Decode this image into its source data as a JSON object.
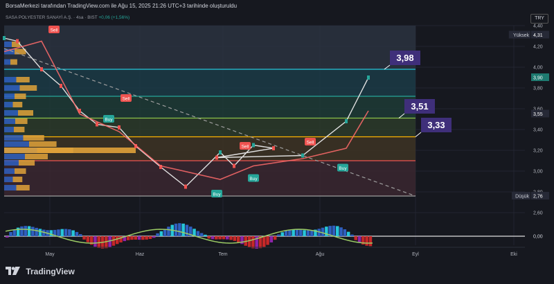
{
  "header": {
    "attribution": "BorsaMerkezi tarafından TradingView.com ile Ağu 15, 2025 21:26 UTC+3 tarihinde oluşturuldu",
    "symbol": "SASA POLYESTER SANAYİ A.Ş. · 4sa · BIST",
    "change": "+0,06 (+1,56%)",
    "currency": "TRY"
  },
  "footer": {
    "brand": "TradingView"
  },
  "chart_data": {
    "type": "line",
    "title": "SASA POLYESTER SANAYİ A.Ş. · 4sa · BIST",
    "y_axis": {
      "range": [
        2.6,
        4.4
      ],
      "ticks": [
        "4,40",
        "4,20",
        "4,00",
        "3,80",
        "3,60",
        "3,40",
        "3,20",
        "3,00",
        "2,80",
        "2,60"
      ],
      "tick_values": [
        4.4,
        4.2,
        4.0,
        3.8,
        3.6,
        3.4,
        3.2,
        3.0,
        2.8,
        2.6
      ]
    },
    "x_axis": {
      "ticks": [
        "May",
        "Haz",
        "Tem",
        "Ağu",
        "Eyl",
        "Eki"
      ]
    },
    "price_labels": [
      {
        "label": "Yüksek",
        "value": "4,31",
        "num": 4.31
      },
      {
        "label": "",
        "value": "3,90",
        "num": 3.9
      },
      {
        "label": "",
        "value": "3,55",
        "num": 3.55
      },
      {
        "label": "Düşük",
        "value": "2,76",
        "num": 2.76
      }
    ],
    "levels": [
      {
        "value": "3,98",
        "num": 3.98,
        "color": "#26c6da"
      },
      {
        "value": "3,51",
        "num": 3.51,
        "color": "#8bc34a"
      },
      {
        "value": "3,33",
        "num": 3.33,
        "color": "#ffb300"
      },
      {
        "value": "",
        "num": 3.1,
        "color": "#ef5350"
      },
      {
        "value": "",
        "num": 2.76,
        "color": "#9e9e9e"
      },
      {
        "value": "",
        "num": 3.72,
        "color": "#26a69a"
      }
    ],
    "series": [
      {
        "name": "price",
        "x": [
          "Nis 22",
          "Nis 29",
          "May 6",
          "May 13",
          "May 20",
          "May 27",
          "Haz 3",
          "Haz 10",
          "Haz 17",
          "Haz 24",
          "Tem 1",
          "Tem 8",
          "Tem 15",
          "Tem 22",
          "Tem 29",
          "Ağu 5",
          "Ağu 12",
          "Ağu 15"
        ],
        "values": [
          4.28,
          4.25,
          3.98,
          3.82,
          3.58,
          3.45,
          3.42,
          3.24,
          3.04,
          2.85,
          3.18,
          3.05,
          3.25,
          3.22,
          3.13,
          3.15,
          3.48,
          3.9
        ]
      },
      {
        "name": "trailing stop",
        "x": [
          "Nis 22",
          "May 6",
          "May 20",
          "Haz 3",
          "Haz 17",
          "Tem 1",
          "Tem 15",
          "Ağu 5",
          "Ağu 12",
          "Ağu 15"
        ],
        "values": [
          4.15,
          4.25,
          3.55,
          3.38,
          3.05,
          2.92,
          3.05,
          3.12,
          3.22,
          3.58
        ]
      }
    ],
    "signals": [
      {
        "text": "Sell",
        "x": "May 1",
        "y": 4.36
      },
      {
        "text": "Sell",
        "x": "Haz 1",
        "y": 3.7
      },
      {
        "text": "Buy",
        "x": "May 31",
        "y": 3.5
      },
      {
        "text": "Sell",
        "x": "Tem 20",
        "y": 3.24
      },
      {
        "text": "Buy",
        "x": "Tem 29",
        "y": 2.78
      },
      {
        "text": "Sell",
        "x": "Ağu 7",
        "y": 3.28
      },
      {
        "text": "Buy",
        "x": "Ağu 10",
        "y": 2.93
      },
      {
        "text": "Buy",
        "x": "Ağu 26",
        "y": 3.03
      }
    ],
    "oscillator": {
      "zero_label": "0,00",
      "zero_value": 0.0
    },
    "grid": true
  }
}
